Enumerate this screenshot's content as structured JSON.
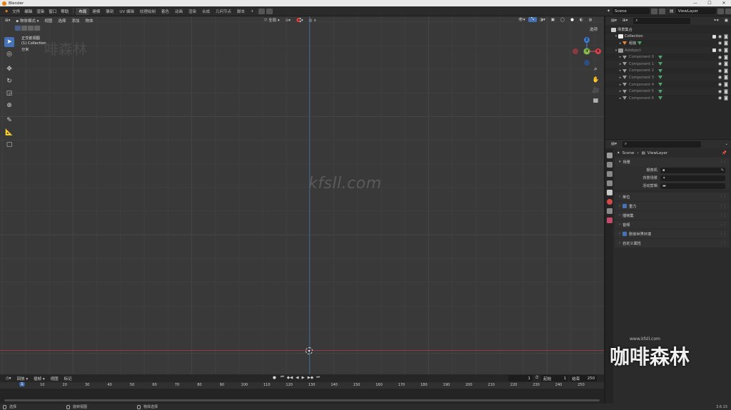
{
  "window": {
    "title": "Blender",
    "buttons": [
      "—",
      "☐",
      "✕"
    ]
  },
  "menu": [
    "文件",
    "编辑",
    "渲染",
    "窗口",
    "帮助"
  ],
  "workspaces": [
    {
      "label": "布局",
      "active": true
    },
    {
      "label": "建模"
    },
    {
      "label": "雕刻"
    },
    {
      "label": "UV 编辑"
    },
    {
      "label": "纹理绘制"
    },
    {
      "label": "着色"
    },
    {
      "label": "动画"
    },
    {
      "label": "渲染"
    },
    {
      "label": "合成"
    },
    {
      "label": "几何节点"
    },
    {
      "label": "脚本"
    }
  ],
  "add_workspace": "+",
  "scene_field": "Scene",
  "viewlayer_field": "ViewLayer",
  "viewport": {
    "mode": "物体模式",
    "menus": [
      "视图",
      "选择",
      "添加",
      "物体"
    ],
    "transform_orientation": "全局",
    "options_label": "选项",
    "info_lines": [
      "正交前视图",
      "(1) Collection",
      "分米"
    ],
    "watermark_url": "kfsll.com",
    "watermark_cn": "啡森林"
  },
  "gizmo": {
    "z": "Z",
    "x": "X",
    "y": "Y",
    "neg_y": "-Y"
  },
  "outliner": {
    "root": "场景集合",
    "rows": [
      {
        "label": "Collection",
        "indent": 1,
        "type": "collection"
      },
      {
        "label": "组装",
        "indent": 2,
        "type": "mesh-orange"
      },
      {
        "label": "Adobject",
        "indent": 1,
        "type": "collection-grey"
      },
      {
        "label": "Component 0",
        "indent": 2,
        "type": "mesh-grey"
      },
      {
        "label": "Component 1",
        "indent": 2,
        "type": "mesh-grey"
      },
      {
        "label": "Component 2",
        "indent": 2,
        "type": "mesh-grey"
      },
      {
        "label": "Component 3",
        "indent": 2,
        "type": "mesh-grey"
      },
      {
        "label": "Component 4",
        "indent": 2,
        "type": "mesh-grey"
      },
      {
        "label": "Component 5",
        "indent": 2,
        "type": "mesh-grey"
      },
      {
        "label": "Component 6",
        "indent": 2,
        "type": "mesh-grey"
      }
    ]
  },
  "properties": {
    "breadcrumb": [
      "Scene",
      "ViewLayer"
    ],
    "panels": [
      {
        "title": "场景",
        "open": true,
        "rows": [
          {
            "label": "摄像机",
            "value": ""
          },
          {
            "label": "背景场景",
            "value": ""
          },
          {
            "label": "活动剪辑",
            "value": ""
          }
        ]
      },
      {
        "title": "单位",
        "open": false
      },
      {
        "title": "重力",
        "open": false,
        "checkbox": true
      },
      {
        "title": "插帧集",
        "open": false
      },
      {
        "title": "音频",
        "open": false
      },
      {
        "title": "刚体世界环境",
        "open": false,
        "checkbox": true
      },
      {
        "title": "自定义属性",
        "open": false
      }
    ]
  },
  "timeline": {
    "menus": [
      "回放",
      "插帧",
      "视图",
      "标记"
    ],
    "current_frame": "1",
    "start_label": "起始",
    "start": "1",
    "end_label": "结束",
    "end": "250",
    "ticks": [
      "1",
      "10",
      "20",
      "30",
      "40",
      "50",
      "60",
      "70",
      "80",
      "90",
      "100",
      "110",
      "120",
      "130",
      "140",
      "150",
      "160",
      "170",
      "180",
      "190",
      "200",
      "210",
      "220",
      "230",
      "240",
      "250"
    ],
    "playhead_label": "1"
  },
  "statusbar": {
    "items": [
      "选择",
      "旋转视图",
      "物体选择"
    ],
    "version": "3.6.15"
  },
  "watermark_corner": {
    "url": "www.kfsll.com",
    "text": "咖啡森林"
  }
}
